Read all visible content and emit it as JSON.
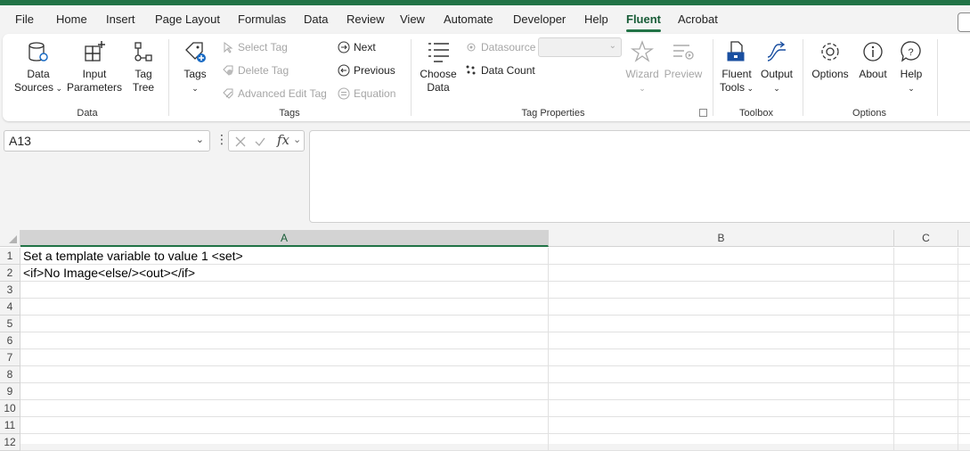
{
  "menu": {
    "items": [
      "File",
      "Home",
      "Insert",
      "Page Layout",
      "Formulas",
      "Data",
      "Review",
      "View",
      "Automate",
      "Developer",
      "Help",
      "Fluent",
      "Acrobat"
    ],
    "active": "Fluent"
  },
  "ribbon": {
    "data_group": {
      "label": "Data",
      "data_sources": "Data\nSources",
      "input_parameters": "Input\nParameters",
      "tag_tree": "Tag\nTree"
    },
    "tags_group": {
      "label": "Tags",
      "tags": "Tags",
      "select_tag": "Select Tag",
      "delete_tag": "Delete Tag",
      "advanced_edit_tag": "Advanced Edit Tag",
      "next": "Next",
      "previous": "Previous",
      "equation": "Equation"
    },
    "tag_properties_group": {
      "label": "Tag Properties",
      "choose_data": "Choose\nData",
      "datasource": "Datasource",
      "data_count": "Data Count",
      "wizard": "Wizard",
      "preview": "Preview"
    },
    "toolbox_group": {
      "label": "Toolbox",
      "fluent_tools": "Fluent\nTools",
      "output": "Output"
    },
    "options_group": {
      "label": "Options",
      "options": "Options",
      "about": "About",
      "help": "Help"
    }
  },
  "formula_bar": {
    "name_box": "A13",
    "formula": ""
  },
  "sheet": {
    "columns": [
      "A",
      "B",
      "C"
    ],
    "selected_column": "A",
    "rows": [
      "1",
      "2",
      "3",
      "4",
      "5",
      "6",
      "7",
      "8",
      "9",
      "10",
      "11",
      "12"
    ],
    "cells": {
      "A1": "Set a template variable to value 1 <set>",
      "A2": "<if>No Image<else/><out></if>"
    }
  },
  "colors": {
    "accent": "#217346",
    "active_tab": "#185c37"
  }
}
